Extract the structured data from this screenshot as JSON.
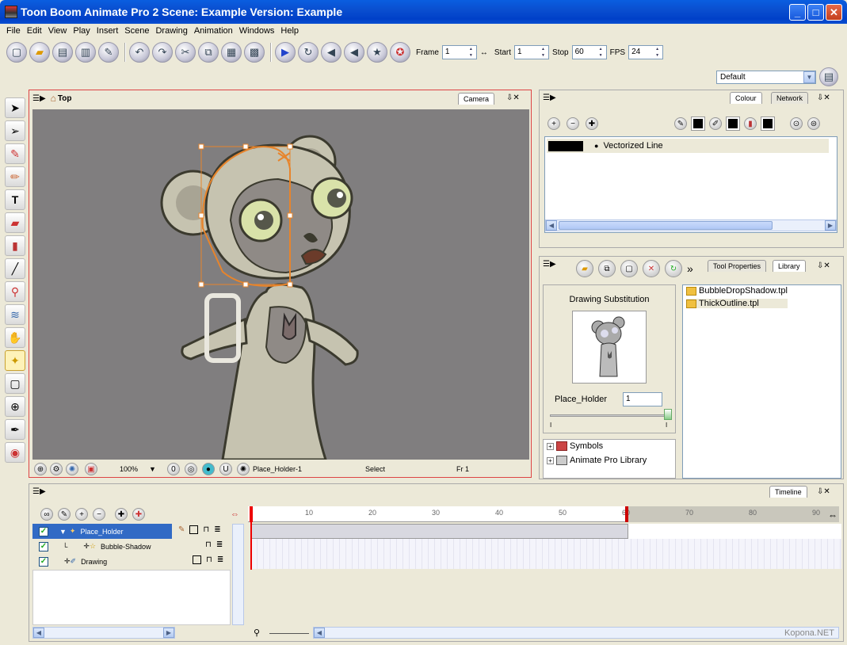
{
  "window": {
    "title": "Toon Boom Animate Pro 2 Scene: Example Version: Example",
    "min": "_",
    "max": "□",
    "close": "✕"
  },
  "menu": [
    "File",
    "Edit",
    "View",
    "Play",
    "Insert",
    "Scene",
    "Drawing",
    "Animation",
    "Windows",
    "Help"
  ],
  "toolbar": {
    "frame_label": "Frame",
    "frame_value": "1",
    "start_label": "Start",
    "start_value": "1",
    "stop_label": "Stop",
    "stop_value": "60",
    "fps_label": "FPS",
    "fps_value": "24",
    "workspace": "Default"
  },
  "camera_view": {
    "breadcrumb": "Top",
    "tab": "Camera",
    "zoom": "100%",
    "node": "Place_Holder-1",
    "tool": "Select",
    "frame": "Fr 1"
  },
  "colour_panel": {
    "tabs": [
      "Colour",
      "Network"
    ],
    "swatch_name": "Vectorized Line"
  },
  "library_panel": {
    "tabs": [
      "Tool Properties",
      "Library"
    ],
    "heading": "Drawing Substitution",
    "drawing_name": "Place_Holder",
    "drawing_value": "1",
    "slider_min": "I",
    "slider_max": "I",
    "tree": [
      "Symbols",
      "Animate Pro Library"
    ],
    "files": [
      "BubbleDropShadow.tpl",
      "ThickOutline.tpl"
    ]
  },
  "timeline": {
    "tab": "Timeline",
    "layers": [
      {
        "name": "Place_Holder",
        "selected": true
      },
      {
        "name": "Bubble-Shadow",
        "selected": false
      },
      {
        "name": "Drawing",
        "selected": false
      }
    ],
    "ruler": [
      "10",
      "20",
      "30",
      "40",
      "50",
      "60",
      "70",
      "80",
      "90"
    ],
    "playhead_frame": 1,
    "stop_frame": 60
  },
  "watermark": "Kopona.NET",
  "colors": {
    "selection": "#316ac5",
    "camera_border": "#dd4444",
    "viewport_bg": "#807e7f"
  }
}
